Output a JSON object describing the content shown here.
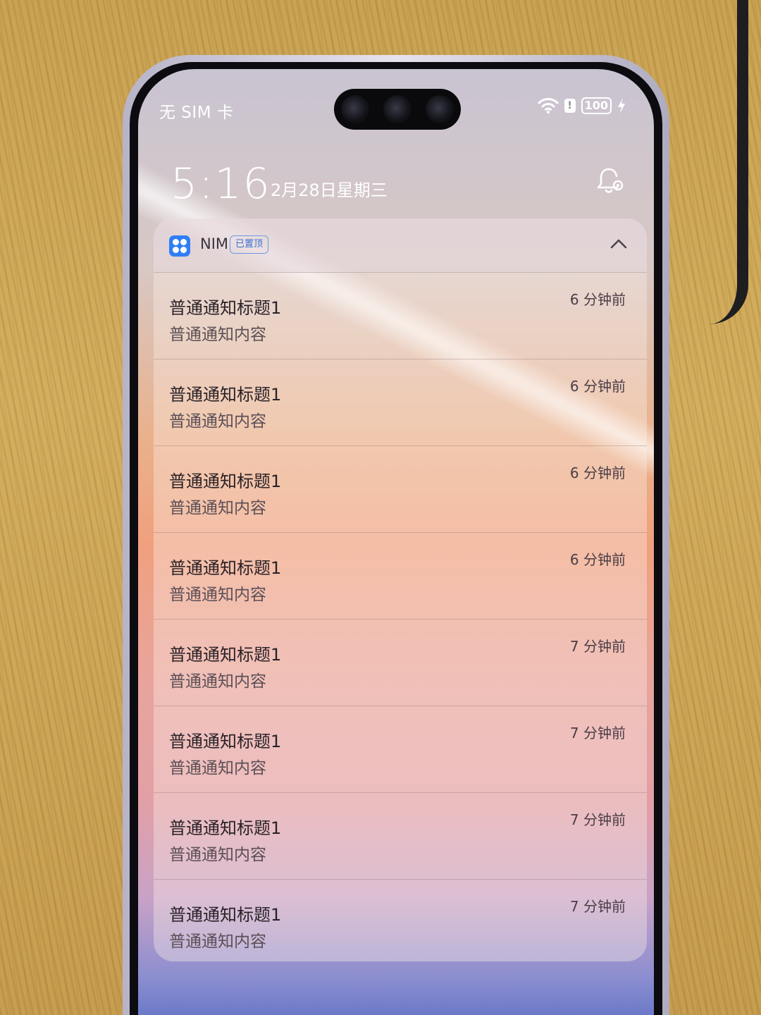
{
  "status_bar": {
    "carrier": "无 SIM 卡",
    "battery": "100",
    "alert": "!"
  },
  "lockscreen": {
    "time": "5:16",
    "date": "2月28日星期三"
  },
  "notification_group": {
    "app_name": "NIM",
    "badge": "已置顶",
    "app_icon_color": "#2f7ef5",
    "items": [
      {
        "title": "普通通知标题1",
        "body": "普通通知内容",
        "time": "6 分钟前"
      },
      {
        "title": "普通通知标题1",
        "body": "普通通知内容",
        "time": "6 分钟前"
      },
      {
        "title": "普通通知标题1",
        "body": "普通通知内容",
        "time": "6 分钟前"
      },
      {
        "title": "普通通知标题1",
        "body": "普通通知内容",
        "time": "6 分钟前"
      },
      {
        "title": "普通通知标题1",
        "body": "普通通知内容",
        "time": "7 分钟前"
      },
      {
        "title": "普通通知标题1",
        "body": "普通通知内容",
        "time": "7 分钟前"
      },
      {
        "title": "普通通知标题1",
        "body": "普通通知内容",
        "time": "7 分钟前"
      },
      {
        "title": "普通通知标题1",
        "body": "普通通知内容",
        "time": "7 分钟前"
      }
    ]
  },
  "icons": {
    "wifi": "wifi-icon",
    "bell_settings": "bell-settings-icon",
    "collapse": "chevron-up-icon",
    "charging": "charging-bolt-icon"
  }
}
